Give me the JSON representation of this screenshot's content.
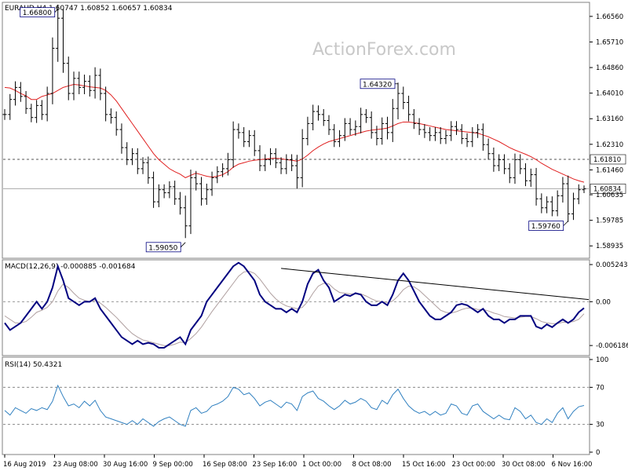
{
  "watermark": "ActionForex.com",
  "chart_data": [
    {
      "type": "line",
      "name": "price",
      "title": "EURAUD,H4  1.60747 1.60852 1.60657 1.60834",
      "ylim": [
        1.5855,
        1.67
      ],
      "y_ticks": [
        "1.66560",
        "1.65710",
        "1.64860",
        "1.64010",
        "1.63160",
        "1.62310",
        "1.61460",
        "1.60635",
        "1.59785",
        "1.58935"
      ],
      "x_labels": [
        "16 Aug 2019",
        "23 Aug 08:00",
        "30 Aug 16:00",
        "9 Sep 00:00",
        "16 Sep 08:00",
        "23 Sep 16:00",
        "1 Oct 00:00",
        "8 Oct 08:00",
        "15 Oct 16:00",
        "23 Oct 00:00",
        "30 Oct 08:00",
        "6 Nov 16:00"
      ],
      "close": [
        1.633,
        1.638,
        1.642,
        1.639,
        1.635,
        1.632,
        1.636,
        1.633,
        1.64,
        1.655,
        1.665,
        1.65,
        1.64,
        1.645,
        1.642,
        1.644,
        1.641,
        1.646,
        1.64,
        1.633,
        1.632,
        1.628,
        1.622,
        1.618,
        1.62,
        1.615,
        1.617,
        1.612,
        1.604,
        1.608,
        1.607,
        1.609,
        1.605,
        1.602,
        1.596,
        1.612,
        1.61,
        1.605,
        1.608,
        1.612,
        1.614,
        1.615,
        1.618,
        1.628,
        1.627,
        1.624,
        1.626,
        1.621,
        1.616,
        1.618,
        1.62,
        1.617,
        1.615,
        1.618,
        1.616,
        1.612,
        1.625,
        1.63,
        1.634,
        1.633,
        1.631,
        1.628,
        1.624,
        1.626,
        1.63,
        1.628,
        1.629,
        1.633,
        1.632,
        1.627,
        1.625,
        1.63,
        1.627,
        1.635,
        1.64,
        1.637,
        1.633,
        1.63,
        1.628,
        1.627,
        1.626,
        1.627,
        1.625,
        1.626,
        1.629,
        1.628,
        1.625,
        1.624,
        1.627,
        1.628,
        1.623,
        1.62,
        1.616,
        1.618,
        1.615,
        1.612,
        1.618,
        1.615,
        1.611,
        1.613,
        1.605,
        1.602,
        1.604,
        1.601,
        1.606,
        1.61,
        1.6,
        1.605,
        1.608,
        1.6083
      ],
      "range": [
        0.004,
        0.004,
        0.0045,
        0.004,
        0.004,
        0.0035,
        0.004,
        0.004,
        0.005,
        0.008,
        0.01,
        0.007,
        0.005,
        0.005,
        0.005,
        0.005,
        0.0045,
        0.006,
        0.005,
        0.005,
        0.0045,
        0.0045,
        0.0045,
        0.004,
        0.004,
        0.004,
        0.004,
        0.0045,
        0.0045,
        0.004,
        0.004,
        0.004,
        0.0045,
        0.005,
        0.009,
        0.006,
        0.005,
        0.005,
        0.0045,
        0.0045,
        0.004,
        0.004,
        0.005,
        0.006,
        0.0045,
        0.004,
        0.004,
        0.004,
        0.004,
        0.004,
        0.004,
        0.004,
        0.004,
        0.004,
        0.004,
        0.008,
        0.007,
        0.005,
        0.005,
        0.0045,
        0.004,
        0.004,
        0.004,
        0.004,
        0.004,
        0.004,
        0.0045,
        0.005,
        0.004,
        0.0045,
        0.005,
        0.0045,
        0.005,
        0.007,
        0.008,
        0.005,
        0.005,
        0.004,
        0.004,
        0.004,
        0.004,
        0.004,
        0.004,
        0.004,
        0.004,
        0.004,
        0.004,
        0.004,
        0.004,
        0.004,
        0.0045,
        0.0045,
        0.0045,
        0.004,
        0.004,
        0.004,
        0.0045,
        0.004,
        0.004,
        0.0045,
        0.005,
        0.004,
        0.004,
        0.004,
        0.004,
        0.005,
        0.006,
        0.0045,
        0.004,
        0.0025
      ],
      "moving_average": [
        1.642,
        1.6418,
        1.641,
        1.64,
        1.6392,
        1.638,
        1.638,
        1.639,
        1.6395,
        1.64,
        1.641,
        1.642,
        1.6425,
        1.643,
        1.6428,
        1.6425,
        1.6422,
        1.642,
        1.6418,
        1.641,
        1.6395,
        1.6375,
        1.635,
        1.6325,
        1.63,
        1.6275,
        1.625,
        1.6225,
        1.62,
        1.618,
        1.6165,
        1.615,
        1.614,
        1.6132,
        1.612,
        1.6128,
        1.6135,
        1.613,
        1.6125,
        1.6122,
        1.6125,
        1.613,
        1.614,
        1.6155,
        1.6165,
        1.617,
        1.6175,
        1.6178,
        1.618,
        1.6182,
        1.6184,
        1.6185,
        1.6183,
        1.618,
        1.6178,
        1.6175,
        1.6182,
        1.6195,
        1.621,
        1.6222,
        1.6232,
        1.624,
        1.6245,
        1.625,
        1.6255,
        1.626,
        1.6265,
        1.627,
        1.6275,
        1.6278,
        1.628,
        1.6282,
        1.6285,
        1.6292,
        1.63,
        1.6305,
        1.6305,
        1.6303,
        1.63,
        1.6296,
        1.6292,
        1.6288,
        1.6284,
        1.628,
        1.6278,
        1.6276,
        1.6274,
        1.6272,
        1.627,
        1.6268,
        1.6262,
        1.6256,
        1.6248,
        1.624,
        1.623,
        1.622,
        1.6212,
        1.6205,
        1.6198,
        1.619,
        1.618,
        1.6168,
        1.6158,
        1.6148,
        1.614,
        1.6132,
        1.6124,
        1.6116,
        1.611,
        1.6105
      ],
      "horizontal_levels": [
        {
          "value": 1.6181,
          "label": "1.61810",
          "style": "dashed"
        },
        {
          "value": 1.60834,
          "label": "1.60834",
          "style": "solid"
        }
      ],
      "annotations": [
        {
          "label": "1.66800",
          "value": 1.668,
          "bar": 10
        },
        {
          "label": "1.59050",
          "value": 1.5905,
          "bar": 34
        },
        {
          "label": "1.64320",
          "value": 1.6432,
          "bar": 74
        },
        {
          "label": "1.59760",
          "value": 1.5976,
          "bar": 106
        }
      ],
      "colors": {
        "price": "#000000",
        "moving_average": "#e02020",
        "grid": "#bbbbbb"
      }
    },
    {
      "type": "line",
      "name": "macd",
      "title": "MACD(12,26,9) -0.000885 -0.001684",
      "ylim": [
        -0.0075,
        0.0058
      ],
      "y_ticks": [
        "0.005243",
        "0.00",
        "-0.006186"
      ],
      "macd": [
        -0.003,
        -0.004,
        -0.0035,
        -0.003,
        -0.002,
        -0.001,
        0.0,
        -0.001,
        0.0,
        0.002,
        0.005,
        0.003,
        0.0005,
        0.0,
        -0.0005,
        0.0,
        0.0,
        0.0005,
        -0.001,
        -0.002,
        -0.003,
        -0.004,
        -0.005,
        -0.0055,
        -0.006,
        -0.0055,
        -0.006,
        -0.0058,
        -0.006,
        -0.0065,
        -0.0065,
        -0.006,
        -0.0055,
        -0.005,
        -0.006,
        -0.004,
        -0.003,
        -0.002,
        0.0,
        0.001,
        0.002,
        0.003,
        0.004,
        0.005,
        0.0055,
        0.005,
        0.004,
        0.003,
        0.001,
        0.0,
        -0.0005,
        -0.001,
        -0.001,
        -0.0015,
        -0.001,
        -0.0015,
        0.0,
        0.0025,
        0.004,
        0.0045,
        0.003,
        0.002,
        0.0,
        0.0005,
        0.001,
        0.0008,
        0.0012,
        0.001,
        0.0,
        -0.0005,
        -0.0005,
        0.0,
        -0.0005,
        0.001,
        0.003,
        0.004,
        0.003,
        0.0015,
        0.0,
        -0.001,
        -0.002,
        -0.0025,
        -0.0025,
        -0.002,
        -0.0015,
        -0.0005,
        -0.0003,
        -0.0005,
        -0.001,
        -0.0015,
        -0.001,
        -0.002,
        -0.0025,
        -0.0025,
        -0.003,
        -0.0025,
        -0.0025,
        -0.002,
        -0.002,
        -0.002,
        -0.0035,
        -0.0038,
        -0.0032,
        -0.0036,
        -0.003,
        -0.0025,
        -0.003,
        -0.0025,
        -0.0015,
        -0.0009
      ],
      "signal": [
        -0.002,
        -0.0025,
        -0.003,
        -0.003,
        -0.0028,
        -0.0022,
        -0.0015,
        -0.0012,
        -0.0008,
        0.0,
        0.0015,
        0.0025,
        0.002,
        0.0012,
        0.0005,
        0.0002,
        0.0,
        0.0002,
        -0.0002,
        -0.0008,
        -0.0015,
        -0.0022,
        -0.003,
        -0.0038,
        -0.0045,
        -0.005,
        -0.0054,
        -0.0056,
        -0.0058,
        -0.006,
        -0.0062,
        -0.0062,
        -0.006,
        -0.0057,
        -0.0058,
        -0.0052,
        -0.0045,
        -0.0036,
        -0.0025,
        -0.0014,
        -0.0004,
        0.0006,
        0.0016,
        0.0026,
        0.0036,
        0.0042,
        0.0043,
        0.004,
        0.0032,
        0.0022,
        0.0012,
        0.0004,
        -0.0002,
        -0.0006,
        -0.0008,
        -0.001,
        -0.0008,
        0.0,
        0.0012,
        0.0022,
        0.0026,
        0.0025,
        0.0018,
        0.0013,
        0.0012,
        0.0011,
        0.0011,
        0.0011,
        0.0008,
        0.0004,
        0.0001,
        0.0,
        -0.0001,
        0.0001,
        0.0008,
        0.0017,
        0.0022,
        0.0021,
        0.0016,
        0.0009,
        0.0002,
        -0.0005,
        -0.0012,
        -0.0015,
        -0.0016,
        -0.0014,
        -0.0011,
        -0.0009,
        -0.0009,
        -0.0011,
        -0.0011,
        -0.0013,
        -0.0016,
        -0.0018,
        -0.0021,
        -0.0022,
        -0.0023,
        -0.0022,
        -0.0021,
        -0.0021,
        -0.0024,
        -0.0028,
        -0.003,
        -0.0031,
        -0.0031,
        -0.0029,
        -0.0029,
        -0.0028,
        -0.0025,
        -0.0017
      ],
      "trendline": [
        {
          "bar": 52,
          "value": 0.0047
        },
        {
          "bar": 110,
          "value": 0.0003
        }
      ],
      "colors": {
        "macd": "#000080",
        "signal": "#b0a0a0",
        "trendline": "#000000"
      }
    },
    {
      "type": "line",
      "name": "rsi",
      "title": "RSI(14) 50.4321",
      "ylim": [
        0,
        100
      ],
      "y_ticks": [
        "100",
        "70",
        "30",
        "0"
      ],
      "levels": [
        70,
        30
      ],
      "rsi": [
        45,
        40,
        48,
        45,
        42,
        47,
        45,
        48,
        46,
        55,
        72,
        60,
        50,
        52,
        48,
        55,
        50,
        56,
        45,
        38,
        36,
        34,
        32,
        30,
        34,
        30,
        36,
        32,
        28,
        33,
        36,
        38,
        34,
        30,
        28,
        45,
        48,
        42,
        44,
        50,
        52,
        55,
        60,
        70,
        68,
        62,
        64,
        58,
        50,
        54,
        56,
        52,
        48,
        54,
        52,
        45,
        60,
        64,
        66,
        58,
        55,
        50,
        46,
        50,
        56,
        52,
        54,
        58,
        55,
        48,
        46,
        56,
        52,
        62,
        68,
        58,
        50,
        45,
        42,
        44,
        40,
        44,
        40,
        42,
        52,
        50,
        42,
        40,
        50,
        52,
        44,
        40,
        36,
        40,
        36,
        35,
        48,
        44,
        36,
        40,
        32,
        30,
        36,
        32,
        42,
        48,
        36,
        44,
        49,
        50.4
      ],
      "colors": {
        "rsi": "#3080c0",
        "level": "#888888"
      }
    }
  ]
}
